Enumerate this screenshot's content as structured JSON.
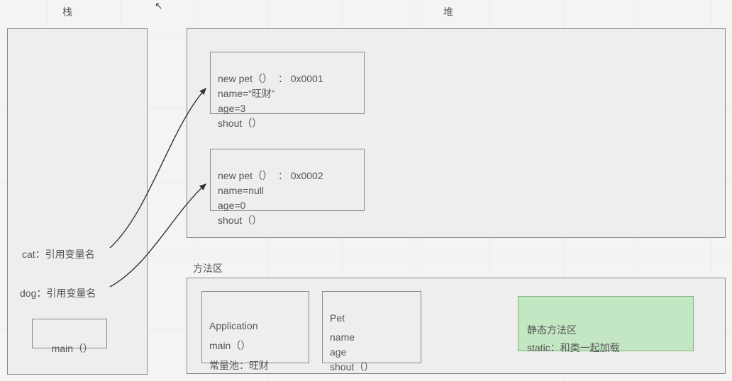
{
  "titles": {
    "stack": "栈",
    "heap": "堆",
    "method_area": "方法区"
  },
  "stack": {
    "cat_line": "cat：引用变量名",
    "dog_line": "dog：引用变量名",
    "main_label": "main（）"
  },
  "heap": {
    "obj1": {
      "l1": "new pet（）  ： 0x0001",
      "l2": "name=“旺财”",
      "l3": "age=3",
      "l4": "shout（）"
    },
    "obj2": {
      "l1": "new pet（）  ： 0x0002",
      "l2": "name=null",
      "l3": "age=0",
      "l4": "shout（）"
    }
  },
  "method_area": {
    "application": {
      "l1": "Application",
      "l2": "main（）",
      "l3": "常量池：旺财"
    },
    "pet": {
      "l1": "Pet",
      "l2": "name",
      "l3": "age",
      "l4": "shout（）"
    },
    "static_box": {
      "l1": "静态方法区",
      "l2": "static：和类一起加载"
    }
  },
  "cursor_glyph": "↖"
}
